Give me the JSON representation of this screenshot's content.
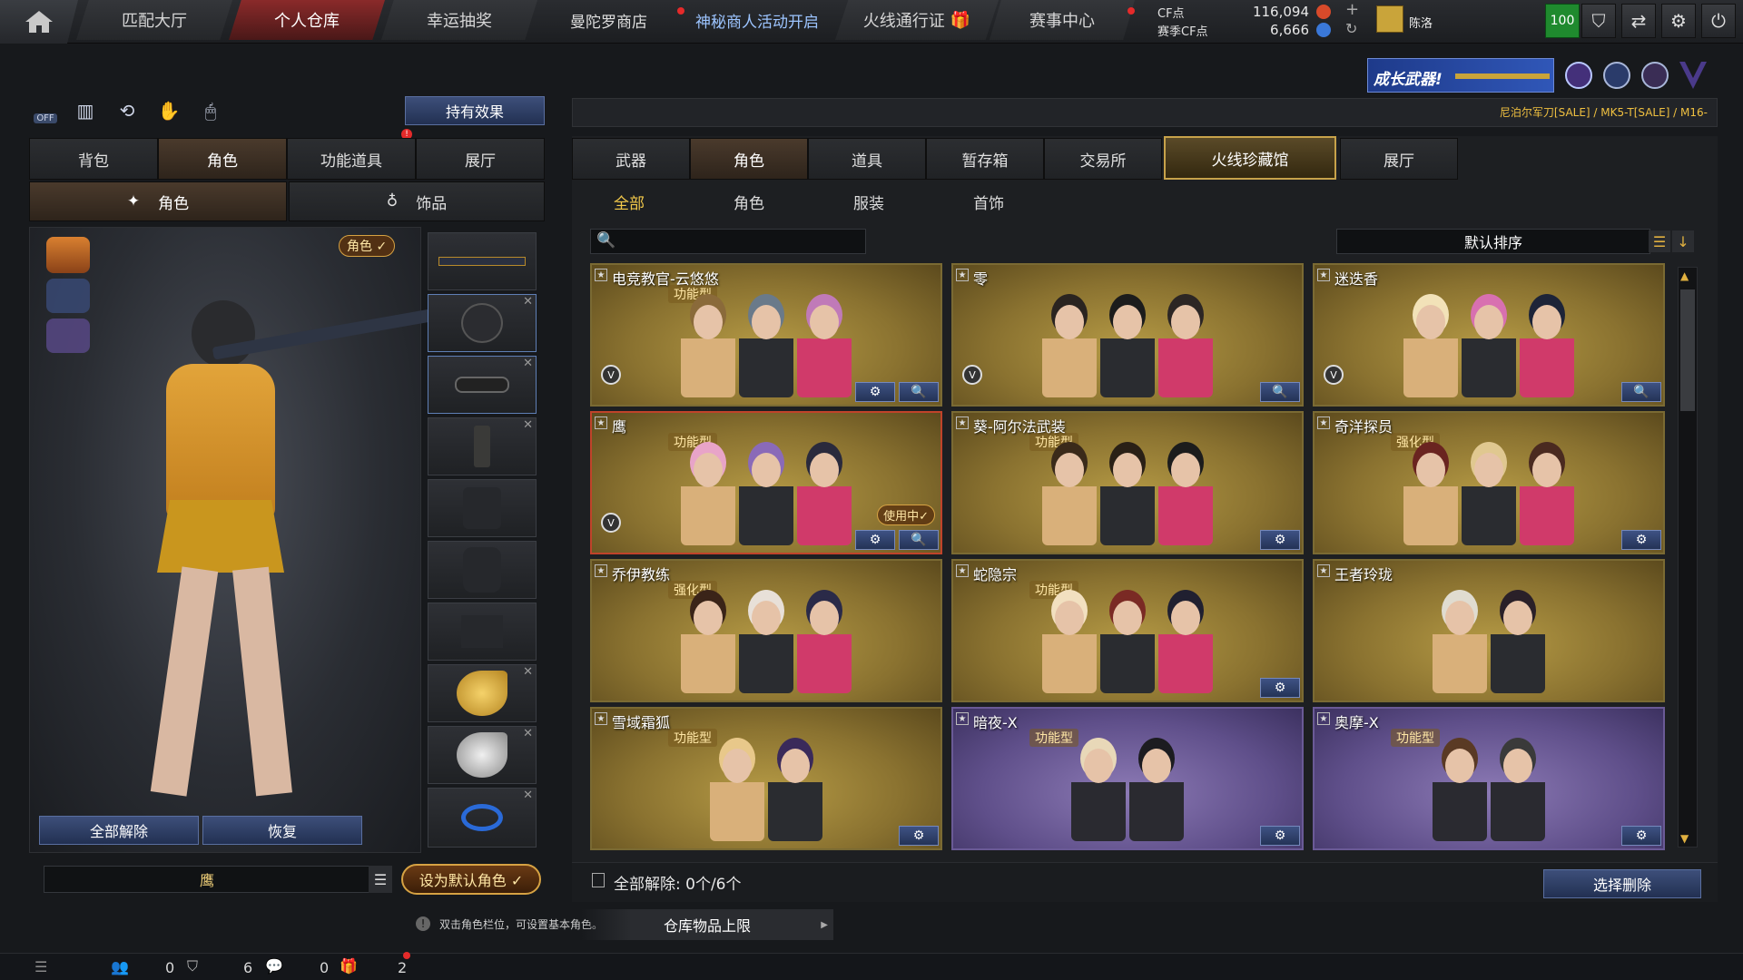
{
  "topnav": {
    "tabs": [
      {
        "label": "匹配大厅"
      },
      {
        "label": "个人仓库"
      },
      {
        "label": "幸运抽奖"
      }
    ],
    "links": [
      {
        "label": "曼陀罗商店"
      },
      {
        "label": "神秘商人活动开启"
      },
      {
        "label": "火线通行证"
      },
      {
        "label": "赛事中心"
      }
    ],
    "currency": {
      "cf_label": "CF点",
      "cf_value": "116,094",
      "season_label": "赛季CF点",
      "season_value": "6,666"
    },
    "clan_label": "陈洛",
    "level": "100"
  },
  "banner": {
    "promo_text": "成长武器!",
    "ticker": "尼泊尔军刀[SALE] / MK5-T[SALE] / M16-"
  },
  "left": {
    "effects_button": "持有效果",
    "off_label": "OFF",
    "tabs": [
      "背包",
      "角色",
      "功能道具",
      "展厅"
    ],
    "subtabs": [
      "角色",
      "饰品"
    ],
    "role_tag": "角色 ✓",
    "release_all": "全部解除",
    "restore": "恢复",
    "current_name": "鹰",
    "set_default": "设为默认角色 ✓",
    "hint": "双击角色栏位，可设置基本角色。",
    "capacity": "仓库物品上限"
  },
  "right": {
    "tabs": [
      "武器",
      "角色",
      "道具",
      "暂存箱",
      "交易所",
      "火线珍藏馆",
      "展厅"
    ],
    "subtabs": [
      "全部",
      "角色",
      "服装",
      "首饰"
    ],
    "search_placeholder": "",
    "sort_label": "默认排序",
    "cards": [
      {
        "name": "电竞教官-云悠悠",
        "tag": "功能型"
      },
      {
        "name": "零",
        "tag": ""
      },
      {
        "name": "迷迭香",
        "tag": ""
      },
      {
        "name": "鹰",
        "tag": "功能型",
        "status": "使用中✓"
      },
      {
        "name": "葵-阿尔法武装",
        "tag": "功能型"
      },
      {
        "name": "奇洋探员",
        "tag": "强化型"
      },
      {
        "name": "乔伊教练",
        "tag": "强化型"
      },
      {
        "name": "蛇隐宗",
        "tag": "功能型"
      },
      {
        "name": "王者玲珑",
        "tag": ""
      },
      {
        "name": "雪域霜狐",
        "tag": "功能型"
      },
      {
        "name": "暗夜-X",
        "tag": "功能型"
      },
      {
        "name": "奥摩-X",
        "tag": "功能型"
      }
    ],
    "release_status": "全部解除:  0个/6个",
    "select_delete": "选择删除"
  },
  "bottombar": {
    "counts": [
      "0",
      "6",
      "0",
      "2"
    ]
  },
  "colors": {
    "accent_gold": "#b59a45",
    "accent_purple": "#6a5a96",
    "nav_active": "#8a2a2a",
    "button_blue": "#2d3e66"
  }
}
